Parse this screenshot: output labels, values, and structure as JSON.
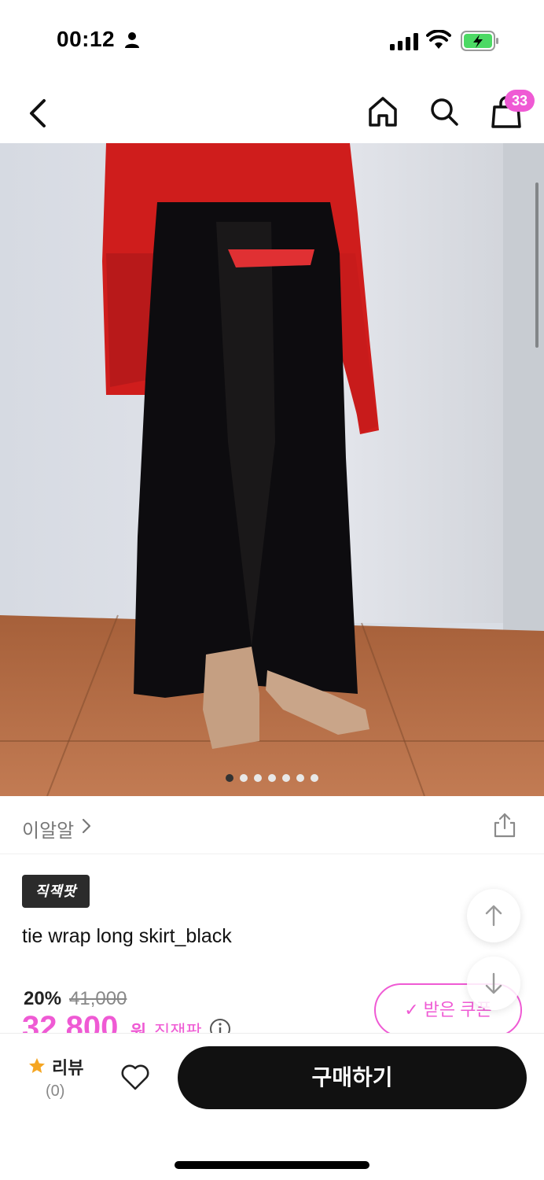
{
  "status_bar": {
    "time": "00:12",
    "icons": [
      "person-icon",
      "signal-icon",
      "wifi-icon",
      "battery-charging-icon"
    ]
  },
  "nav": {
    "icons": [
      "back-icon",
      "home-icon",
      "search-icon",
      "shopping-bag-icon"
    ],
    "cart_badge": "33"
  },
  "gallery": {
    "image_count": 7,
    "current_index": 1,
    "image_description_icons": [
      "product-photo"
    ]
  },
  "brand": {
    "name": "이알알"
  },
  "product": {
    "tag": "직잭팟",
    "title": "tie wrap long skirt_black"
  },
  "price": {
    "discount_rate": "20%",
    "original_price": "41,000",
    "sale_price": "32,800",
    "currency_unit": "원",
    "price_label": "직잭팟"
  },
  "coupon": {
    "label": "받은 쿠폰"
  },
  "bottom_bar": {
    "review_label": "리뷰",
    "review_count": "(0)",
    "buy_label": "구매하기"
  },
  "colors": {
    "accent": "#ef5ad4",
    "buy_button": "#111111"
  }
}
